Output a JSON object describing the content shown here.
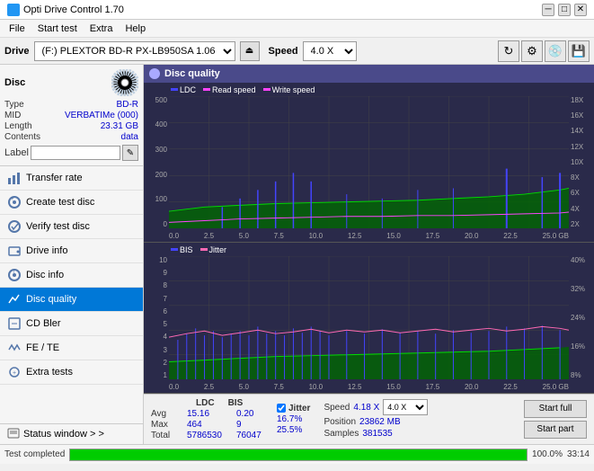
{
  "titlebar": {
    "title": "Opti Drive Control 1.70",
    "minimize": "─",
    "maximize": "□",
    "close": "✕"
  },
  "menubar": {
    "items": [
      "File",
      "Start test",
      "Extra",
      "Help"
    ]
  },
  "drivebar": {
    "label": "Drive",
    "drive_value": "(F:)  PLEXTOR BD-R  PX-LB950SA 1.06",
    "speed_label": "Speed",
    "speed_value": "4.0 X"
  },
  "disc": {
    "title": "Disc",
    "type_label": "Type",
    "type_value": "BD-R",
    "mid_label": "MID",
    "mid_value": "VERBATIMe (000)",
    "length_label": "Length",
    "length_value": "23.31 GB",
    "contents_label": "Contents",
    "contents_value": "data",
    "label_label": "Label",
    "label_placeholder": ""
  },
  "nav": {
    "items": [
      {
        "label": "Transfer rate",
        "icon": "chart-icon"
      },
      {
        "label": "Create test disc",
        "icon": "disc-icon"
      },
      {
        "label": "Verify test disc",
        "icon": "verify-icon"
      },
      {
        "label": "Drive info",
        "icon": "info-icon"
      },
      {
        "label": "Disc info",
        "icon": "disc-info-icon"
      },
      {
        "label": "Disc quality",
        "icon": "quality-icon",
        "active": true
      },
      {
        "label": "CD Bler",
        "icon": "bler-icon"
      },
      {
        "label": "FE / TE",
        "icon": "fe-te-icon"
      },
      {
        "label": "Extra tests",
        "icon": "extra-icon"
      }
    ]
  },
  "status_window": {
    "label": "Status window > >"
  },
  "chart_panel": {
    "title": "Disc quality"
  },
  "chart_top": {
    "legend": [
      {
        "label": "LDC",
        "color": "#0000ff"
      },
      {
        "label": "Read speed",
        "color": "#ff00ff"
      },
      {
        "label": "Write speed",
        "color": "#00ff00"
      }
    ],
    "y_left": [
      "500",
      "400",
      "300",
      "200",
      "100",
      "0"
    ],
    "y_right": [
      "18X",
      "16X",
      "14X",
      "12X",
      "10X",
      "8X",
      "6X",
      "4X",
      "2X"
    ],
    "x_labels": [
      "0.0",
      "2.5",
      "5.0",
      "7.5",
      "10.0",
      "12.5",
      "15.0",
      "17.5",
      "20.0",
      "22.5",
      "25.0 GB"
    ]
  },
  "chart_bottom": {
    "legend": [
      {
        "label": "BIS",
        "color": "#0000ff"
      },
      {
        "label": "Jitter",
        "color": "#ff69b4"
      }
    ],
    "y_left": [
      "10",
      "9",
      "8",
      "7",
      "6",
      "5",
      "4",
      "3",
      "2",
      "1"
    ],
    "y_right": [
      "40%",
      "32%",
      "24%",
      "16%",
      "8%"
    ],
    "x_labels": [
      "0.0",
      "2.5",
      "5.0",
      "7.5",
      "10.0",
      "12.5",
      "15.0",
      "17.5",
      "20.0",
      "22.5",
      "25.0 GB"
    ]
  },
  "stats": {
    "col_headers": [
      "LDC",
      "BIS"
    ],
    "avg_label": "Avg",
    "avg_ldc": "15.16",
    "avg_bis": "0.20",
    "max_label": "Max",
    "max_ldc": "464",
    "max_bis": "9",
    "total_label": "Total",
    "total_ldc": "5786530",
    "total_bis": "76047",
    "jitter_label": "Jitter",
    "jitter_avg": "16.7%",
    "jitter_max": "25.5%",
    "speed_label": "Speed",
    "speed_value": "4.18 X",
    "speed_select": "4.0 X",
    "position_label": "Position",
    "position_value": "23862 MB",
    "samples_label": "Samples",
    "samples_value": "381535",
    "btn_start_full": "Start full",
    "btn_start_part": "Start part"
  },
  "progress": {
    "status_text": "Test completed",
    "progress_pct": 100,
    "progress_label": "100.0%",
    "time_label": "33:14"
  }
}
